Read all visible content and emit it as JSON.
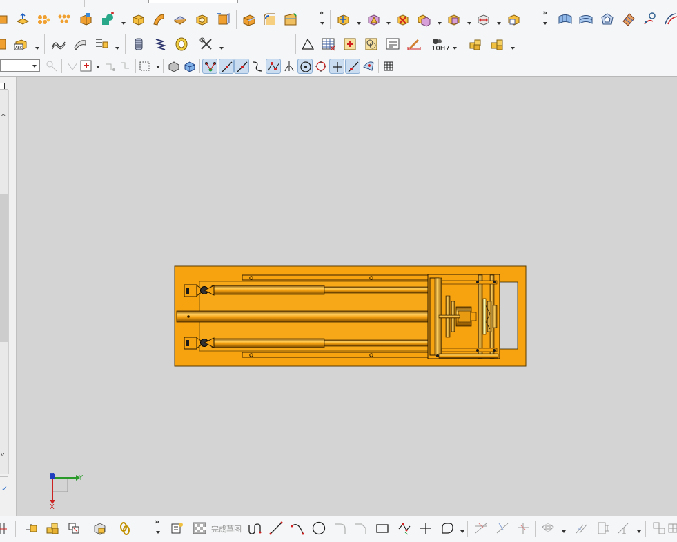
{
  "toolbars": {
    "row1_more": "»",
    "row1_more2": "»",
    "row2": {
      "fit_label": "10H7"
    },
    "row3": {
      "selection_filter_value": ""
    }
  },
  "sketch_toolbar": {
    "more": "»",
    "finish_sketch_label": "完成草图"
  },
  "left_panel": {
    "scroll_up": "^",
    "scroll_down": "v"
  },
  "viewport": {
    "background": "#d4d4d4",
    "model_color": "#f7a20f",
    "triad": {
      "x_label": "X",
      "y_label": "Y",
      "z_label": "Z",
      "x_color": "#cc2222",
      "y_color": "#2a9a2a",
      "z_color": "#2040c0"
    }
  }
}
